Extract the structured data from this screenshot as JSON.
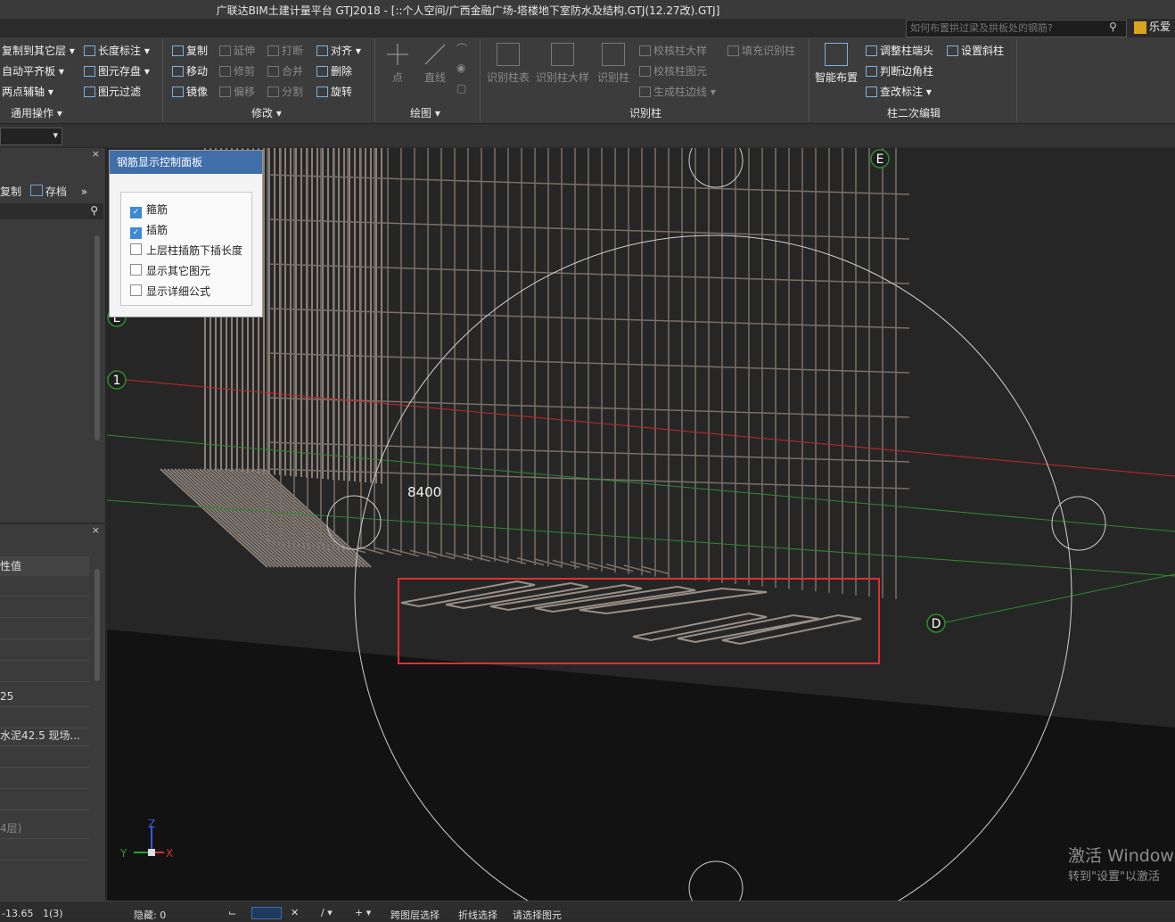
{
  "window": {
    "title": "广联达BIM土建计量平台 GTJ2018 - [::个人空间/广西金融广场-塔楼地下室防水及结构.GTJ(12.27改).GTJ]",
    "search_placeholder": "如何布置拱过梁及拱板处的钢筋?",
    "user_label": "乐爱"
  },
  "ribbon": {
    "general": {
      "items": [
        "复制到其它层 ▾",
        "自动平齐板 ▾",
        "两点辅轴 ▾",
        "长度标注 ▾",
        "图元存盘 ▾",
        "图元过滤"
      ],
      "label": "通用操作 ▾"
    },
    "modify": {
      "items": [
        "复制",
        "延伸",
        "打断",
        "对齐 ▾",
        "移动",
        "修剪",
        "合并",
        "删除",
        "镜像",
        "偏移",
        "分割",
        "旋转"
      ],
      "label": "修改 ▾"
    },
    "draw": {
      "point_label": "点",
      "line_label": "直线",
      "label": "绘图 ▾"
    },
    "identify": {
      "col_table_label": "识别柱表",
      "col_detail_label": "识别柱大样",
      "col_label": "识别柱",
      "check_detail": "校核柱大样",
      "fill_identify": "填充识别柱",
      "check_element": "校核柱图元",
      "gen_edge": "生成柱边线 ▾",
      "label": "识别柱"
    },
    "secondary": {
      "smart_layout": "智能布置",
      "adjust_end": "调整柱端头",
      "set_slant": "设置斜柱",
      "judge_corner": "判断边角柱",
      "check_annotation": "查改标注 ▾",
      "label": "柱二次编辑"
    }
  },
  "left_panel": {
    "tool_copy": "复制",
    "tool_save": "存档",
    "prop_header": "性值",
    "prop_values": [
      "25",
      "水泥42.5  现场...",
      "4层)"
    ]
  },
  "control_panel": {
    "title": "钢筋显示控制面板",
    "options": [
      {
        "label": "箍筋",
        "checked": true
      },
      {
        "label": "插筋",
        "checked": true
      },
      {
        "label": "上层柱插筋下插长度",
        "checked": false
      },
      {
        "label": "显示其它图元",
        "checked": false
      },
      {
        "label": "显示详细公式",
        "checked": false
      }
    ]
  },
  "viewport": {
    "dimension_label": "8400",
    "axis_labels": [
      "E",
      "E",
      "1",
      "D"
    ],
    "triad": {
      "x": "X",
      "y": "Y",
      "z": "Z"
    },
    "highlight_color": "#e03030"
  },
  "status": {
    "coords": "-13.65",
    "floor": "1(3)",
    "hidden": "隐藏: 0",
    "layer_select": "跨图层选择",
    "polyline_select": "折线选择",
    "prompt": "请选择图元"
  },
  "watermark": {
    "line1": "激活 Windows",
    "line2": "转到\"设置\"以激活"
  }
}
